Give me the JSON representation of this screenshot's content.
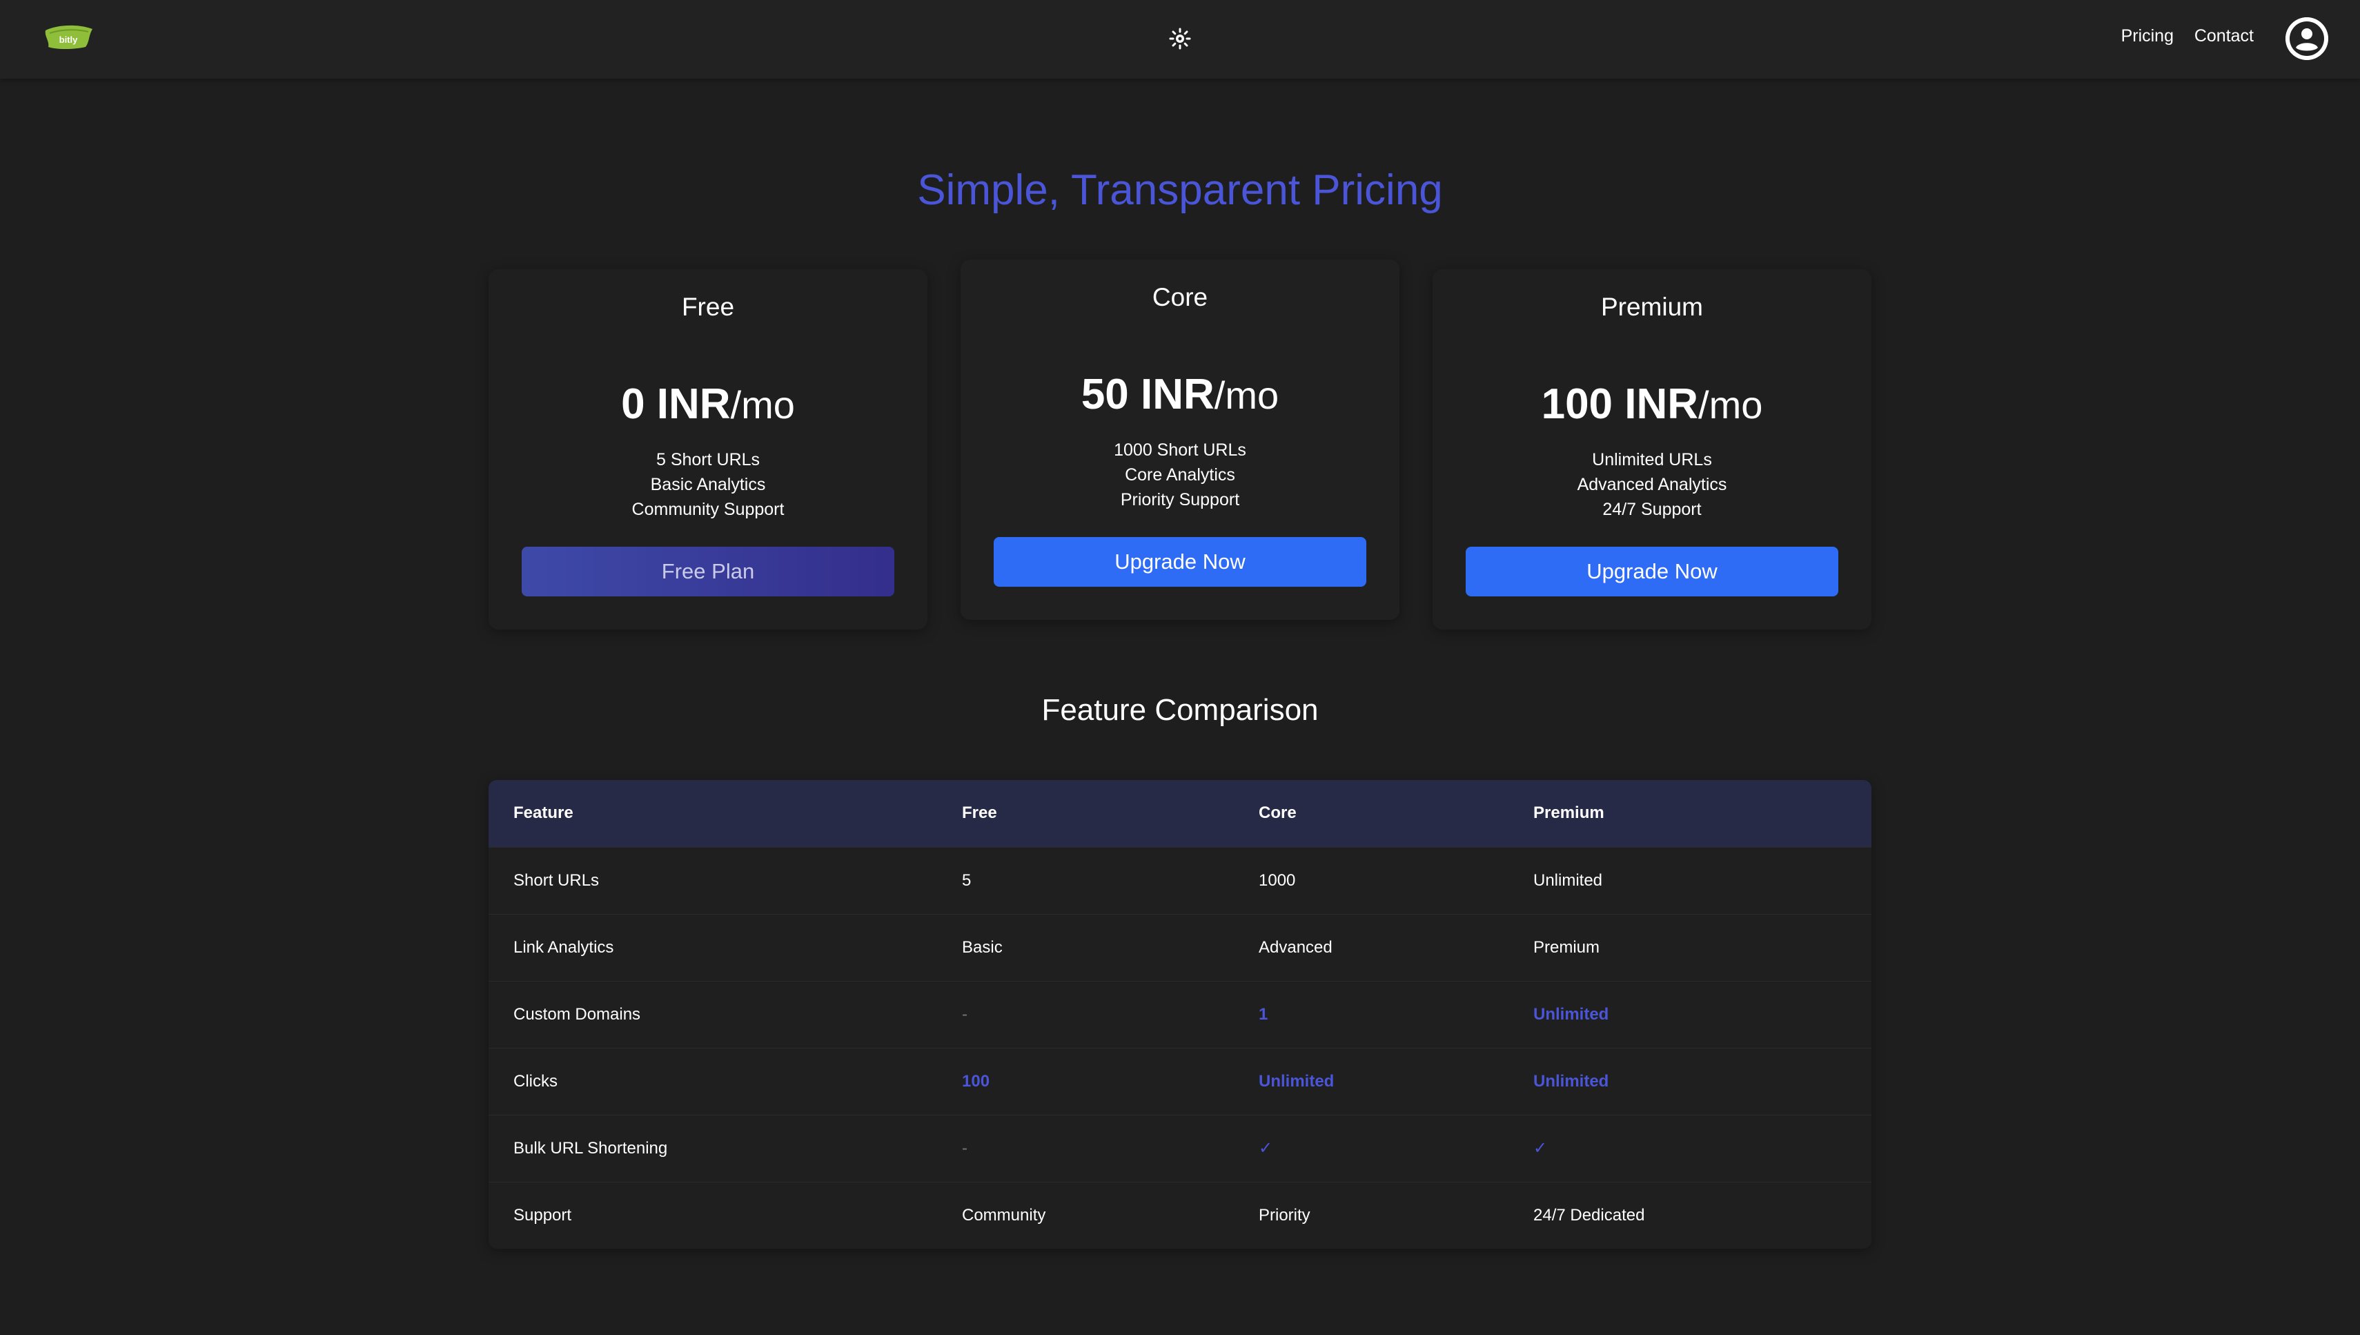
{
  "header": {
    "logo_icon": "leaf-logo",
    "logo_text": "bitly",
    "theme_icon": "sun-icon",
    "nav": {
      "pricing": "Pricing",
      "contact": "Contact"
    },
    "avatar_icon": "user-circle-icon"
  },
  "page_title": "Simple, Transparent Pricing",
  "plans": [
    {
      "name": "Free",
      "price_amount": "0 INR",
      "price_unit": "/mo",
      "features": [
        "5 Short URLs",
        "Basic Analytics",
        "Community Support"
      ],
      "button_label": "Free Plan"
    },
    {
      "name": "Core",
      "price_amount": "50 INR",
      "price_unit": "/mo",
      "features": [
        "1000 Short URLs",
        "Core Analytics",
        "Priority Support"
      ],
      "button_label": "Upgrade Now"
    },
    {
      "name": "Premium",
      "price_amount": "100 INR",
      "price_unit": "/mo",
      "features": [
        "Unlimited URLs",
        "Advanced Analytics",
        "24/7 Support"
      ],
      "button_label": "Upgrade Now"
    }
  ],
  "comparison": {
    "title": "Feature Comparison",
    "headers": [
      "Feature",
      "Free",
      "Core",
      "Premium"
    ],
    "rows": [
      [
        "Short URLs",
        "5",
        "1000",
        "Unlimited"
      ],
      [
        "Link Analytics",
        "Basic",
        "Advanced",
        "Premium"
      ],
      [
        "Custom Domains",
        "-",
        "1",
        "Unlimited"
      ],
      [
        "Clicks",
        "100",
        "Unlimited",
        "Unlimited"
      ],
      [
        "Bulk URL Shortening",
        "-",
        "✓",
        "✓"
      ],
      [
        "Support",
        "Community",
        "Priority",
        "24/7 Dedicated"
      ]
    ]
  },
  "colors": {
    "accent": "#4a55d8",
    "button_blue": "#2f6cf5",
    "background": "#1e1e1e",
    "header_bg": "#222222",
    "table_header_bg": "#262a47"
  }
}
